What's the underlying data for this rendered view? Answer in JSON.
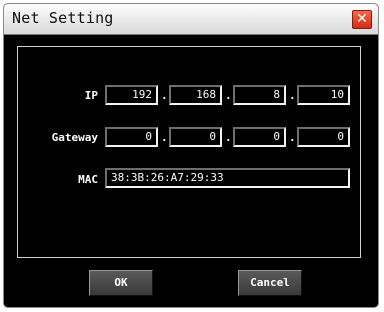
{
  "window": {
    "title": "Net Setting",
    "close_icon": "close-icon"
  },
  "form": {
    "ip": {
      "label": "IP",
      "octets": [
        "192",
        "168",
        "8",
        "10"
      ]
    },
    "gateway": {
      "label": "Gateway",
      "octets": [
        "0",
        "0",
        "0",
        "0"
      ]
    },
    "mac": {
      "label": "MAC",
      "value": "38:3B:26:A7:29:33"
    },
    "separator": "."
  },
  "buttons": {
    "ok": "OK",
    "cancel": "Cancel"
  },
  "colors": {
    "background": "#000000",
    "close": "#e0391f",
    "titlebar": "#e6e6e6"
  }
}
